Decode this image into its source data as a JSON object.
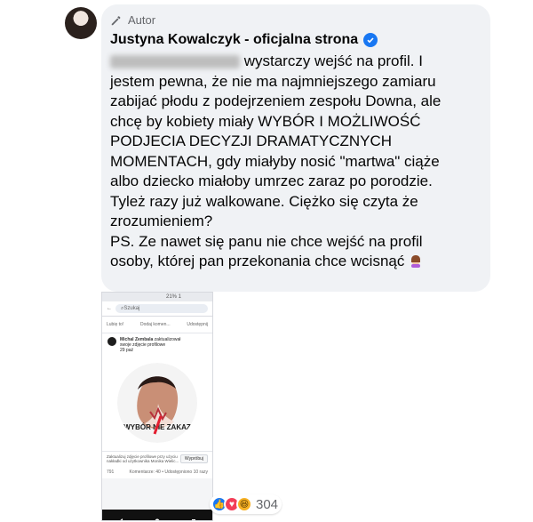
{
  "header": {
    "role_label": "Autor",
    "author_name": "Justyna Kowalczyk - oficjalna strona"
  },
  "comment": {
    "line1_suffix": " wystarczy wejść na profil. I",
    "line2": "jestem pewna, że nie ma najmniejszego zamiaru",
    "line3": "zabijać płodu z podejrzeniem zespołu Downa, ale",
    "line4": "chcę by kobiety miały WYBÓR I MOŻLIWOŚĆ",
    "line5": "PODJECIA DECYZJI DRAMATYCZNYCH",
    "line6": "MOMENTACH, gdy miałyby nosić \"martwa\" ciąże",
    "line7": "albo dziecko miałoby umrzec zaraz po porodzie.",
    "line8": "Tyleż razy już walkowane. Ciężko się czyta że",
    "line9": "zrozumieniem?",
    "line10": "PS. Ze nawet się panu nie chce wejść na profil",
    "line11": "osoby, której pan przekonania chce wcisnąć"
  },
  "phone": {
    "status": "21% 1",
    "search_placeholder": "Szukaj",
    "actions": [
      "Lubię to!",
      "Dodaj komen...",
      "Udostępnij"
    ],
    "post_author": "Michal Zembala",
    "post_action": "zaktualizował",
    "post_subaction": "swoje zdjęcie profilowe",
    "post_time": "29 paź",
    "image_text": "WYBÓR NIE ZAKAZ",
    "share_text": "Zaktualizuj zdjęcie profilowe przy użyciu nakładki od użytkownika Monika Wielic...",
    "share_button": "Wypróbuj",
    "stats_left": "791",
    "stats_right": "Komentarze: 40 • Udostępniono 10 razy"
  },
  "reactions": {
    "count": "304"
  }
}
